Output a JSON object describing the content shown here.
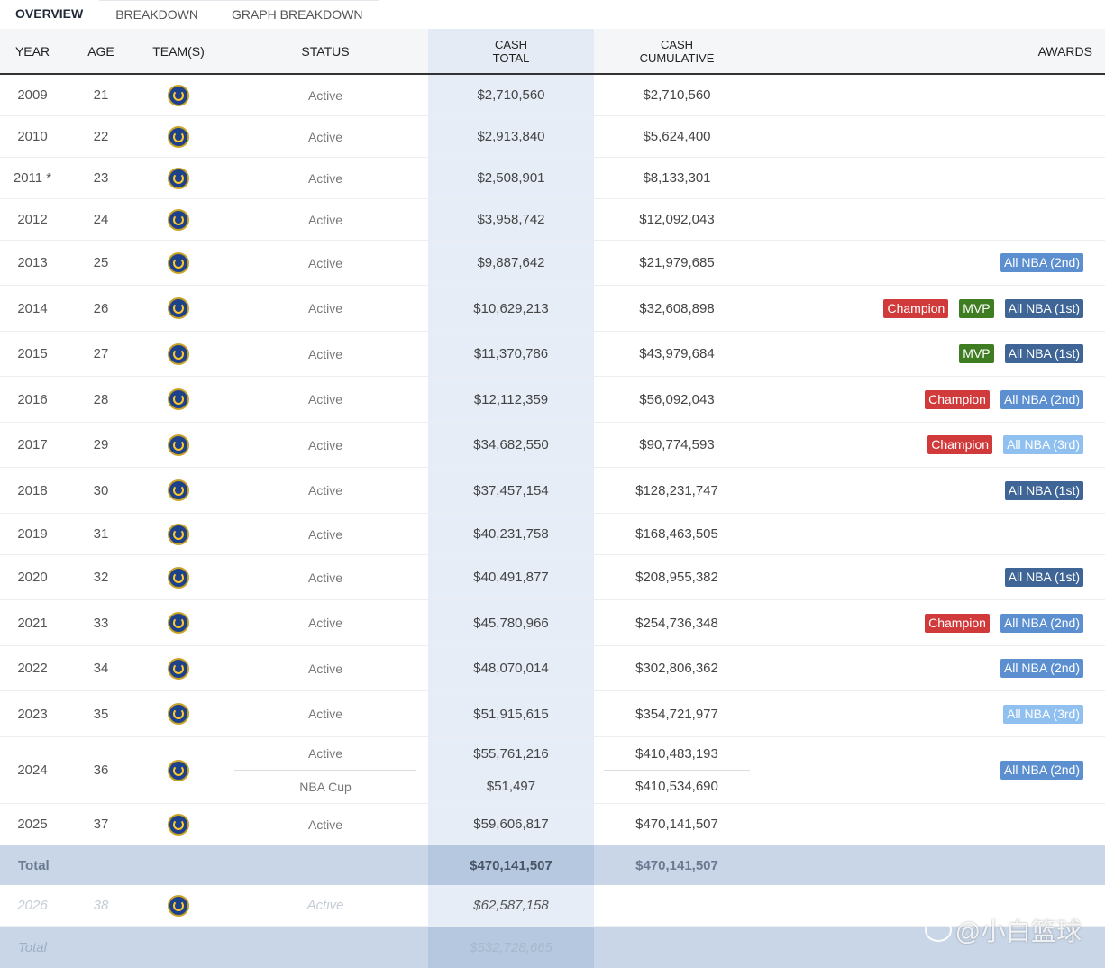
{
  "tabs": [
    "OVERVIEW",
    "BREAKDOWN",
    "GRAPH BREAKDOWN"
  ],
  "headers": {
    "year": "YEAR",
    "age": "AGE",
    "team": "TEAM(S)",
    "status": "STATUS",
    "cash_total_1": "CASH",
    "cash_total_2": "TOTAL",
    "cash_cum_1": "CASH",
    "cash_cum_2": "CUMULATIVE",
    "awards": "AWARDS"
  },
  "rows": [
    {
      "year": "2009",
      "age": "21",
      "status": "Active",
      "cash": "$2,710,560",
      "cum": "$2,710,560",
      "awards": []
    },
    {
      "year": "2010",
      "age": "22",
      "status": "Active",
      "cash": "$2,913,840",
      "cum": "$5,624,400",
      "awards": []
    },
    {
      "year": "2011 *",
      "age": "23",
      "status": "Active",
      "cash": "$2,508,901",
      "cum": "$8,133,301",
      "awards": []
    },
    {
      "year": "2012",
      "age": "24",
      "status": "Active",
      "cash": "$3,958,742",
      "cum": "$12,092,043",
      "awards": []
    },
    {
      "year": "2013",
      "age": "25",
      "status": "Active",
      "cash": "$9,887,642",
      "cum": "$21,979,685",
      "awards": [
        {
          "label": "All NBA (2nd)",
          "color": "blue"
        }
      ]
    },
    {
      "year": "2014",
      "age": "26",
      "status": "Active",
      "cash": "$10,629,213",
      "cum": "$32,608,898",
      "awards": [
        {
          "label": "Champion",
          "color": "red"
        },
        {
          "label": "MVP",
          "color": "green"
        },
        {
          "label": "All NBA (1st)",
          "color": "navy"
        }
      ]
    },
    {
      "year": "2015",
      "age": "27",
      "status": "Active",
      "cash": "$11,370,786",
      "cum": "$43,979,684",
      "awards": [
        {
          "label": "MVP",
          "color": "green"
        },
        {
          "label": "All NBA (1st)",
          "color": "navy"
        }
      ]
    },
    {
      "year": "2016",
      "age": "28",
      "status": "Active",
      "cash": "$12,112,359",
      "cum": "$56,092,043",
      "awards": [
        {
          "label": "Champion",
          "color": "red"
        },
        {
          "label": "All NBA (2nd)",
          "color": "blue"
        }
      ]
    },
    {
      "year": "2017",
      "age": "29",
      "status": "Active",
      "cash": "$34,682,550",
      "cum": "$90,774,593",
      "awards": [
        {
          "label": "Champion",
          "color": "red"
        },
        {
          "label": "All NBA (3rd)",
          "color": "light"
        }
      ]
    },
    {
      "year": "2018",
      "age": "30",
      "status": "Active",
      "cash": "$37,457,154",
      "cum": "$128,231,747",
      "awards": [
        {
          "label": "All NBA (1st)",
          "color": "navy"
        }
      ]
    },
    {
      "year": "2019",
      "age": "31",
      "status": "Active",
      "cash": "$40,231,758",
      "cum": "$168,463,505",
      "awards": []
    },
    {
      "year": "2020",
      "age": "32",
      "status": "Active",
      "cash": "$40,491,877",
      "cum": "$208,955,382",
      "awards": [
        {
          "label": "All NBA (1st)",
          "color": "navy"
        }
      ]
    },
    {
      "year": "2021",
      "age": "33",
      "status": "Active",
      "cash": "$45,780,966",
      "cum": "$254,736,348",
      "awards": [
        {
          "label": "Champion",
          "color": "red"
        },
        {
          "label": "All NBA (2nd)",
          "color": "blue"
        }
      ]
    },
    {
      "year": "2022",
      "age": "34",
      "status": "Active",
      "cash": "$48,070,014",
      "cum": "$302,806,362",
      "awards": [
        {
          "label": "All NBA (2nd)",
          "color": "blue"
        }
      ]
    },
    {
      "year": "2023",
      "age": "35",
      "status": "Active",
      "cash": "$51,915,615",
      "cum": "$354,721,977",
      "awards": [
        {
          "label": "All NBA (3rd)",
          "color": "light"
        }
      ]
    }
  ],
  "split_row": {
    "year": "2024",
    "age": "36",
    "status_1": "Active",
    "status_2": "NBA Cup",
    "cash_1": "$55,761,216",
    "cash_2": "$51,497",
    "cum_1": "$410,483,193",
    "cum_2": "$410,534,690",
    "award": "All NBA (2nd)",
    "award_color": "blue"
  },
  "row_2025": {
    "year": "2025",
    "age": "37",
    "status": "Active",
    "cash": "$59,606,817",
    "cum": "$470,141,507"
  },
  "total": {
    "label": "Total",
    "cash": "$470,141,507",
    "cum": "$470,141,507"
  },
  "future": {
    "year": "2026",
    "age": "38",
    "status": "Active",
    "cash": "$62,587,158"
  },
  "future_total": {
    "label": "Total",
    "cash": "$532,728,665"
  },
  "watermark": "@小白篮球",
  "colors": {
    "red": "#d13a3a",
    "green": "#3f7d22",
    "navy": "#3e6595",
    "blue": "#5b8fd0",
    "light": "#8fc0f0",
    "team_logo": "#1d428a"
  },
  "icons": {
    "team": "warriors-logo-icon"
  }
}
